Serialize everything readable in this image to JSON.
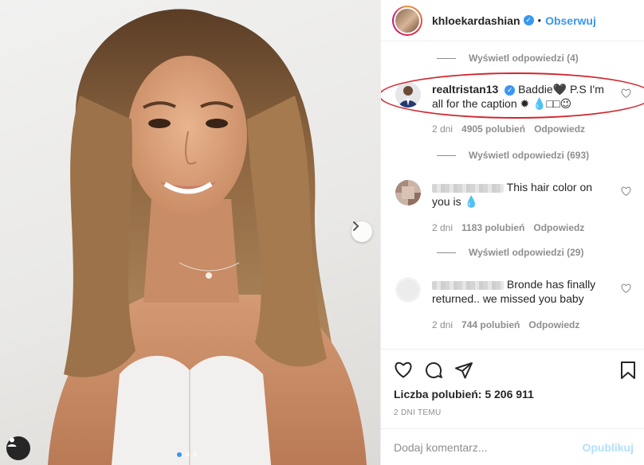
{
  "header": {
    "username": "khloekardashian",
    "separator": "•",
    "follow_label": "Obserwuj"
  },
  "comments": {
    "view_replies": [
      "Wyświetl odpowiedzi (4)",
      "Wyświetl odpowiedzi (693)",
      "Wyświetl odpowiedzi (29)"
    ],
    "items": [
      {
        "username": "realtristan13",
        "text_line1": "Baddie🖤 P.S I'm",
        "text_line2": "all for the caption ✹ 💧□□😉",
        "age": "2 dni",
        "likes": "4905 polubień",
        "reply": "Odpowiedz"
      },
      {
        "username": "",
        "text_line1": "This hair color on",
        "text_line2": "you is 💧",
        "age": "2 dni",
        "likes": "1183 polubień",
        "reply": "Odpowiedz"
      },
      {
        "username": "",
        "text_line1": "Bronde has finally",
        "text_line2": "returned.. we missed you baby",
        "age": "2 dni",
        "likes": "744 polubień",
        "reply": "Odpowiedz"
      }
    ]
  },
  "likes": {
    "label": "Liczba polubień: 5 206 911"
  },
  "timestamp": "2 DNI TEMU",
  "add_comment": {
    "placeholder": "Dodaj komentarz...",
    "publish_label": "Opublikuj"
  },
  "carousel": {
    "slide_count": 3,
    "active_index": 0
  },
  "colors": {
    "accent": "#3897f0",
    "highlight": "#d3262e",
    "publish_disabled": "#b2dffc"
  },
  "icons": [
    "chevron-right-icon",
    "user-tag-icon",
    "verified-icon",
    "heart-icon",
    "comment-icon",
    "share-icon",
    "bookmark-icon"
  ]
}
